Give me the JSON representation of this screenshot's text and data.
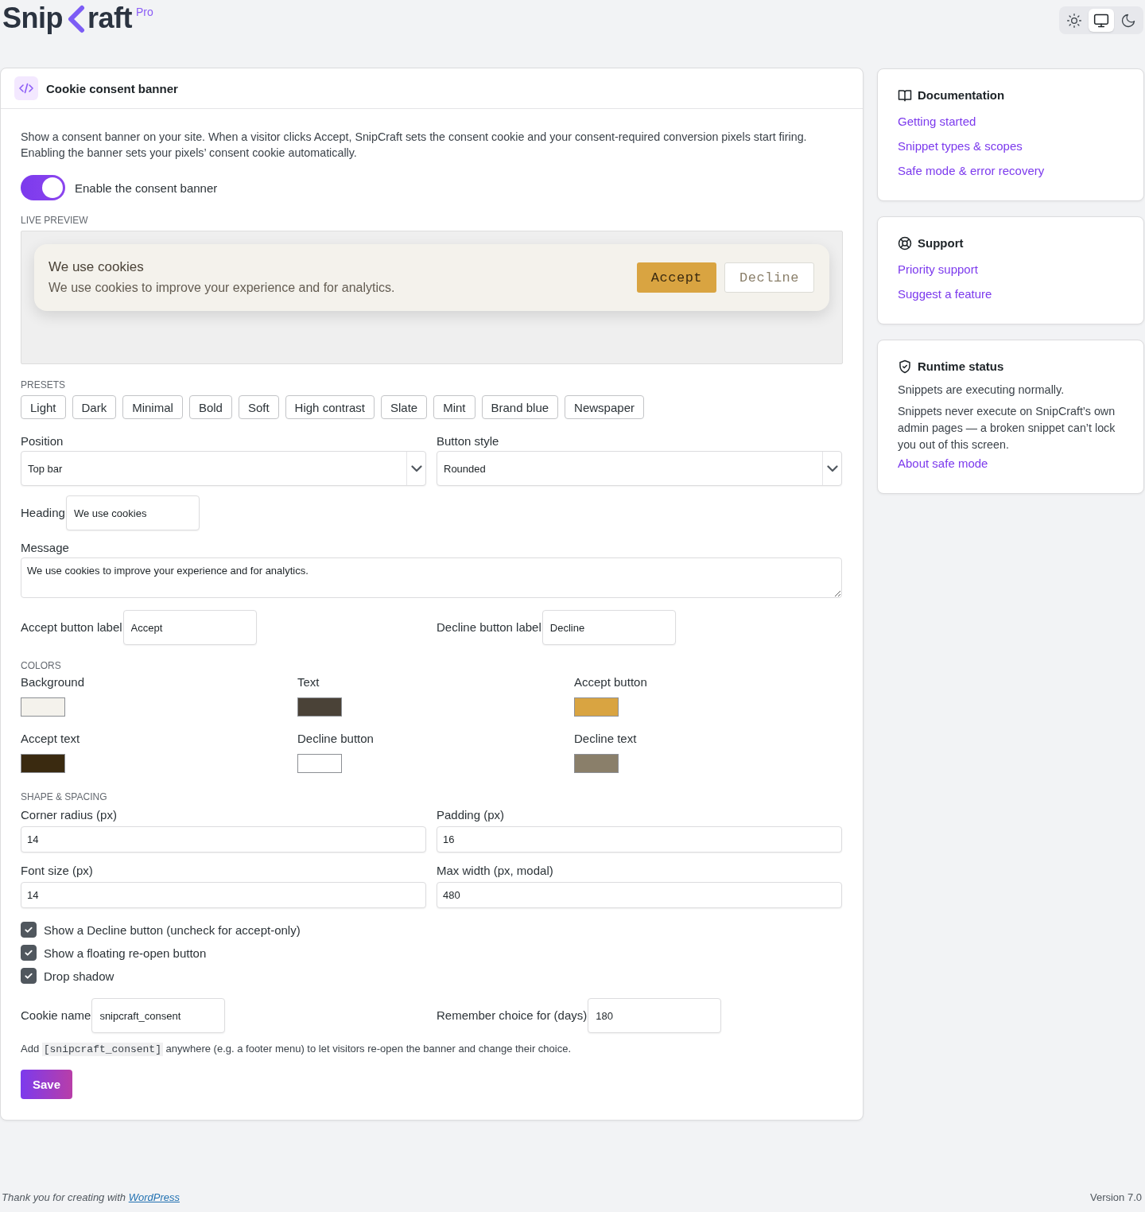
{
  "header": {
    "logo": {
      "before": "Snip",
      "after": "raft",
      "badge": "Pro"
    },
    "theme_switch": [
      {
        "kind": "light",
        "selected": false
      },
      {
        "kind": "system",
        "selected": true
      },
      {
        "kind": "dark",
        "selected": false
      }
    ]
  },
  "main": {
    "title": "Cookie consent banner",
    "description": "Show a consent banner on your site. When a visitor clicks Accept, SnipCraft sets the consent cookie and your consent-required conversion pixels start firing. Enabling the banner sets your pixels’ consent cookie automatically.",
    "enable_toggle": {
      "label": "Enable the consent banner",
      "on": true
    },
    "preview": {
      "label": "LIVE PREVIEW",
      "heading": "We use cookies",
      "message": "We use cookies to improve your experience and for analytics.",
      "accept": "Accept",
      "decline": "Decline"
    },
    "presets": {
      "label": "PRESETS",
      "items": [
        "Light",
        "Dark",
        "Minimal",
        "Bold",
        "Soft",
        "High contrast",
        "Slate",
        "Mint",
        "Brand blue",
        "Newspaper"
      ]
    },
    "selects": [
      {
        "label": "Position",
        "value": "Top bar"
      },
      {
        "label": "Button style",
        "value": "Rounded"
      }
    ],
    "heading_field": {
      "label": "Heading",
      "value": "We use cookies"
    },
    "message_field": {
      "label": "Message",
      "value": "We use cookies to improve your experience and for analytics."
    },
    "label_fields": [
      {
        "label": "Accept button label",
        "value": "Accept"
      },
      {
        "label": "Decline button label",
        "value": "Decline"
      }
    ],
    "colors": {
      "label": "COLORS",
      "items": [
        {
          "label": "Background",
          "color": "#f4f2ec"
        },
        {
          "label": "Text",
          "color": "#4a4237"
        },
        {
          "label": "Accept button",
          "color": "#d9a441"
        },
        {
          "label": "Accept text",
          "color": "#3a2a10"
        },
        {
          "label": "Decline button",
          "color": "#ffffff"
        },
        {
          "label": "Decline text",
          "color": "#8a7f6a"
        }
      ]
    },
    "shape": {
      "label": "SHAPE & SPACING",
      "fields": [
        {
          "label": "Corner radius (px)",
          "value": "14"
        },
        {
          "label": "Padding (px)",
          "value": "16"
        },
        {
          "label": "Font size (px)",
          "value": "14"
        },
        {
          "label": "Max width (px, modal)",
          "value": "480"
        }
      ]
    },
    "checkboxes": [
      {
        "label": "Show a Decline button (uncheck for accept-only)",
        "checked": true
      },
      {
        "label": "Show a floating re-open button",
        "checked": true
      },
      {
        "label": "Drop shadow",
        "checked": true
      }
    ],
    "cookie_fields": [
      {
        "label": "Cookie name",
        "value": "snipcraft_consent"
      },
      {
        "label": "Remember choice for (days)",
        "value": "180"
      }
    ],
    "help": {
      "before": "Add",
      "code": "[snipcraft_consent]",
      "after": "anywhere (e.g. a footer menu) to let visitors re-open the banner and change their choice."
    },
    "save": "Save"
  },
  "sidebar": [
    {
      "kind": "docs",
      "title": "Documentation",
      "links": [
        "Getting started",
        "Snippet types & scopes",
        "Safe mode & error recovery"
      ]
    },
    {
      "kind": "support",
      "title": "Support",
      "links": [
        "Priority support",
        "Suggest a feature"
      ]
    },
    {
      "kind": "status",
      "title": "Runtime status",
      "status": "Snippets are executing normally.",
      "note": "Snippets never execute on SnipCraft’s own admin pages — a broken snippet can’t lock you out of this screen.",
      "links": [
        "About safe mode"
      ]
    }
  ],
  "footer": {
    "credit": "Thank you for creating with",
    "link": "WordPress",
    "version": "Version 7.0"
  }
}
